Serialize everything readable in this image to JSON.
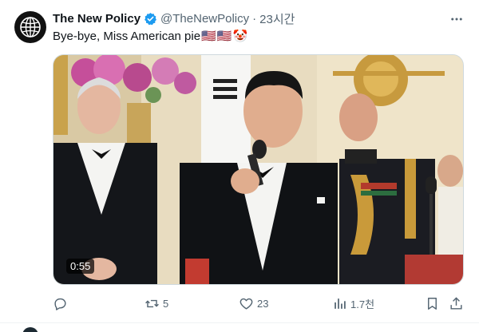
{
  "tweet": {
    "author_name": "The New Policy",
    "handle": "@TheNewPolicy",
    "separator": "·",
    "timestamp": "23시간",
    "text": "Bye-bye, Miss American pie",
    "emojis": [
      "🇺🇸",
      "🇺🇸",
      "🤡"
    ],
    "more_icon": "more-horizontal-icon",
    "verified_icon": "verified-badge-icon",
    "avatar_icon": "globe-icon"
  },
  "media": {
    "type": "video",
    "duration": "0:55"
  },
  "actions": {
    "reply": {
      "icon": "reply-icon",
      "count": ""
    },
    "retweet": {
      "icon": "retweet-icon",
      "count": "5"
    },
    "like": {
      "icon": "heart-icon",
      "count": "23"
    },
    "views": {
      "icon": "views-chart-icon",
      "count": "1.7천"
    },
    "bookmark": {
      "icon": "bookmark-icon"
    },
    "share": {
      "icon": "share-icon"
    }
  },
  "colors": {
    "verified": "#1d9bf0",
    "secondary_text": "#536471",
    "primary_text": "#0f1419"
  }
}
